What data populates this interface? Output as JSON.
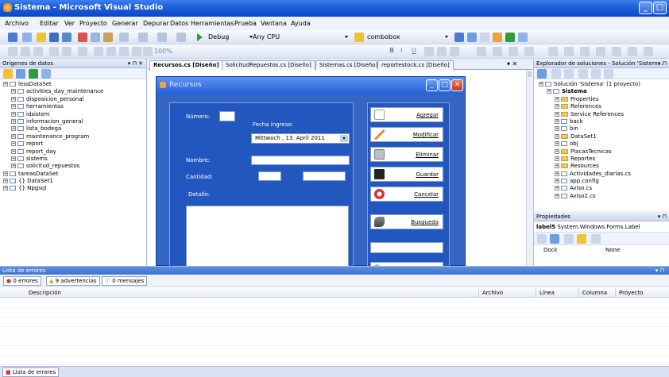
{
  "window": {
    "title": "Sistema - Microsoft Visual Studio"
  },
  "menu": [
    "Archivo",
    "Editar",
    "Ver",
    "Proyecto",
    "Generar",
    "Depurar",
    "Datos",
    "Herramientas",
    "Prueba",
    "Ventana",
    "Ayuda"
  ],
  "toolbar": {
    "config": "Debug",
    "platform": "Any CPU",
    "combo": "combobox",
    "zoom": "100%"
  },
  "datasources": {
    "title": "Orígenes de datos",
    "items": [
      {
        "label": "lessDataSet",
        "level": 0,
        "type": "ds"
      },
      {
        "label": "activities_day_maintenance",
        "level": 1,
        "type": "tbl"
      },
      {
        "label": "disposicion_personal",
        "level": 1,
        "type": "tbl"
      },
      {
        "label": "herramientas",
        "level": 1,
        "type": "tbl"
      },
      {
        "label": "idsistem",
        "level": 1,
        "type": "tbl"
      },
      {
        "label": "informacion_general",
        "level": 1,
        "type": "tbl"
      },
      {
        "label": "lista_bodega",
        "level": 1,
        "type": "tbl"
      },
      {
        "label": "maintenance_program",
        "level": 1,
        "type": "tbl"
      },
      {
        "label": "report",
        "level": 1,
        "type": "tbl"
      },
      {
        "label": "report_day",
        "level": 1,
        "type": "tbl"
      },
      {
        "label": "sistems",
        "level": 1,
        "type": "tbl"
      },
      {
        "label": "solicitud_repuestos",
        "level": 1,
        "type": "tbl"
      },
      {
        "label": "tareasDataSet",
        "level": 0,
        "type": "ds"
      },
      {
        "label": "{} DataSet1",
        "level": 0,
        "type": "ns"
      },
      {
        "label": "{} Npgsql",
        "level": 0,
        "type": "ns"
      }
    ]
  },
  "tabs": [
    "Recursos.cs [Diseño]",
    "SolicitudRepuestos.cs [Diseño]",
    "Sistemas.cs [Diseño]",
    "reportestock.cs [Diseño]"
  ],
  "form": {
    "title": "Recursos",
    "numero_label": "Número:",
    "fecha_label": "Fecha Ingreso:",
    "date": "Mittwoch ,  13.   April   2011",
    "nombre_label": "Nombre:",
    "cantidad_label": "Cantidad:",
    "detalle_label": "Detalle:",
    "buttons": [
      "Agregar",
      "Modificar",
      "Eliminar",
      "Guardar",
      "Cancelar",
      "Busqueda"
    ]
  },
  "solution": {
    "title": "Explorador de soluciones - Solución 'Sistem...",
    "items": [
      {
        "label": "Solución 'Sistema' (1 proyecto)",
        "level": 0,
        "type": "sol"
      },
      {
        "label": "Sistema",
        "level": 1,
        "type": "proj"
      },
      {
        "label": "Properties",
        "level": 2,
        "type": "fold"
      },
      {
        "label": "References",
        "level": 2,
        "type": "fold"
      },
      {
        "label": "Service References",
        "level": 2,
        "type": "fold"
      },
      {
        "label": "back",
        "level": 2,
        "type": "file"
      },
      {
        "label": "bin",
        "level": 2,
        "type": "file"
      },
      {
        "label": "DataSet1",
        "level": 2,
        "type": "fold"
      },
      {
        "label": "obj",
        "level": 2,
        "type": "file"
      },
      {
        "label": "PlacasTecnicas",
        "level": 2,
        "type": "fold"
      },
      {
        "label": "Reportes",
        "level": 2,
        "type": "fold"
      },
      {
        "label": "Resources",
        "level": 2,
        "type": "fold"
      },
      {
        "label": "Actividades_diarias.cs",
        "level": 2,
        "type": "cs"
      },
      {
        "label": "app.config",
        "level": 2,
        "type": "cs"
      },
      {
        "label": "Aviso.cs",
        "level": 2,
        "type": "cs"
      },
      {
        "label": "Aviso2.cs",
        "level": 2,
        "type": "cs"
      }
    ]
  },
  "properties": {
    "title": "Propiedades",
    "object": "label5",
    "object_type": "System.Windows.Forms.Label",
    "row_name": "Dock",
    "row_value": "None"
  },
  "errors": {
    "title": "Lista de errores",
    "errors": "0 errores",
    "warnings": "9 advertencias",
    "messages": "0 mensajes",
    "columns": [
      "Descripción",
      "Archivo",
      "Línea",
      "Columna",
      "Proyecto"
    ],
    "bottom_tab": "Lista de errores"
  }
}
